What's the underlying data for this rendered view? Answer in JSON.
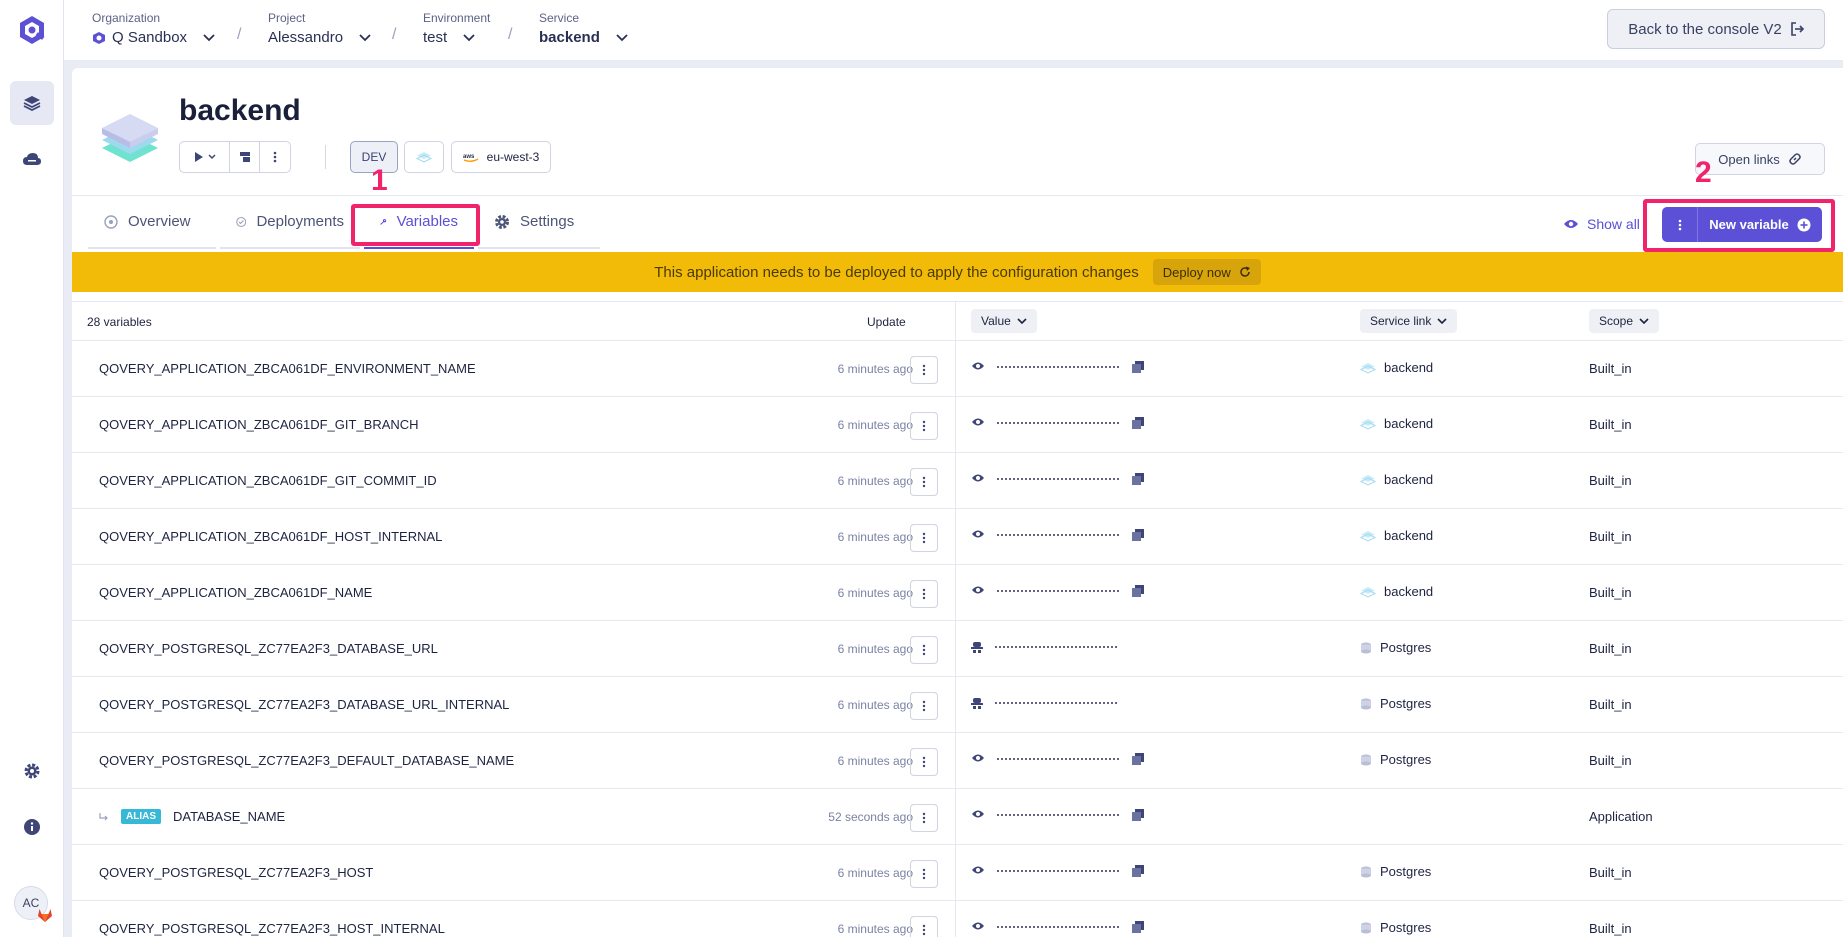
{
  "topbar": {
    "breadcrumbs": [
      {
        "label": "Organization",
        "value": "Q Sandbox"
      },
      {
        "label": "Project",
        "value": "Alessandro"
      },
      {
        "label": "Environment",
        "value": "test"
      },
      {
        "label": "Service",
        "value": "backend"
      }
    ],
    "console_button": "Back to the console V2"
  },
  "sidebar": {
    "avatar": "AC"
  },
  "header": {
    "title": "backend",
    "env_chip": "DEV",
    "region": "eu-west-3",
    "open_links": "Open links"
  },
  "tabs": [
    {
      "label": "Overview"
    },
    {
      "label": "Deployments"
    },
    {
      "label": "Variables"
    },
    {
      "label": "Settings"
    }
  ],
  "annotations": {
    "one": "1",
    "two": "2"
  },
  "actions": {
    "show_all": "Show all",
    "new_variable": "New variable"
  },
  "banner": {
    "text": "This application needs to be deployed to apply the configuration changes",
    "button": "Deploy now"
  },
  "table": {
    "count": "28 variables",
    "update": "Update",
    "value": "Value",
    "service_link": "Service link",
    "scope": "Scope",
    "alias_badge": "ALIAS",
    "rows": [
      {
        "name": "QOVERY_APPLICATION_ZBCA061DF_ENVIRONMENT_NAME",
        "time": "6 minutes ago",
        "service": "backend",
        "scope": "Built_in"
      },
      {
        "name": "QOVERY_APPLICATION_ZBCA061DF_GIT_BRANCH",
        "time": "6 minutes ago",
        "service": "backend",
        "scope": "Built_in"
      },
      {
        "name": "QOVERY_APPLICATION_ZBCA061DF_GIT_COMMIT_ID",
        "time": "6 minutes ago",
        "service": "backend",
        "scope": "Built_in"
      },
      {
        "name": "QOVERY_APPLICATION_ZBCA061DF_HOST_INTERNAL",
        "time": "6 minutes ago",
        "service": "backend",
        "scope": "Built_in"
      },
      {
        "name": "QOVERY_APPLICATION_ZBCA061DF_NAME",
        "time": "6 minutes ago",
        "service": "backend",
        "scope": "Built_in"
      },
      {
        "name": "QOVERY_POSTGRESQL_ZC77EA2F3_DATABASE_URL",
        "time": "6 minutes ago",
        "service": "Postgres",
        "scope": "Built_in"
      },
      {
        "name": "QOVERY_POSTGRESQL_ZC77EA2F3_DATABASE_URL_INTERNAL",
        "time": "6 minutes ago",
        "service": "Postgres",
        "scope": "Built_in"
      },
      {
        "name": "QOVERY_POSTGRESQL_ZC77EA2F3_DEFAULT_DATABASE_NAME",
        "time": "6 minutes ago",
        "service": "Postgres",
        "scope": "Built_in"
      },
      {
        "name": "DATABASE_NAME",
        "time": "52 seconds ago",
        "service": "",
        "scope": "Application"
      },
      {
        "name": "QOVERY_POSTGRESQL_ZC77EA2F3_HOST",
        "time": "6 minutes ago",
        "service": "Postgres",
        "scope": "Built_in"
      },
      {
        "name": "QOVERY_POSTGRESQL_ZC77EA2F3_HOST_INTERNAL",
        "time": "6 minutes ago",
        "service": "Postgres",
        "scope": "Built_in"
      }
    ]
  },
  "colors": {
    "accent": "#5b50d6",
    "highlight": "#f0236b",
    "banner": "#f2bb07"
  }
}
